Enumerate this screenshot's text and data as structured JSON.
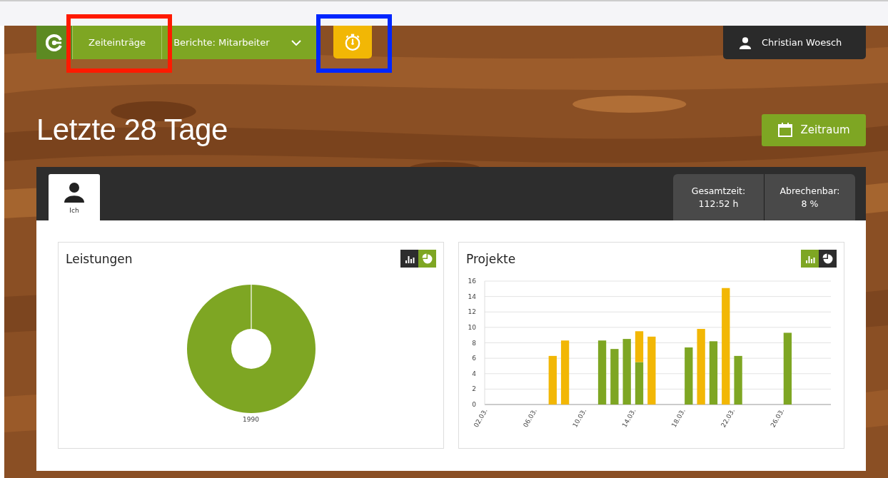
{
  "nav": {
    "items": [
      {
        "label": "Zeiteinträge",
        "selected": true
      },
      {
        "label": "Berichte: Mitarbeiter",
        "selected": false,
        "dropdown": true
      }
    ],
    "user": "Christian Woesch"
  },
  "annotations": [
    {
      "color": "#ff1a00"
    },
    {
      "color": "#0026ff"
    }
  ],
  "page_title": "Letzte 28 Tage",
  "date_button": "Zeitraum",
  "tabs": [
    {
      "label": "Ich",
      "selected": true
    }
  ],
  "stats": [
    {
      "label": "Gesamtzeit:",
      "value": "112:52 h"
    },
    {
      "label": "Abrechenbar:",
      "value": "8 %"
    }
  ],
  "cards": [
    {
      "title": "Leistungen",
      "views": [
        {
          "kind": "bar",
          "selected": false
        },
        {
          "kind": "pie",
          "selected": true
        }
      ],
      "donut": {
        "kind": "donut",
        "slice_label": "1990"
      }
    },
    {
      "title": "Projekte",
      "views": [
        {
          "kind": "bar",
          "selected": true
        },
        {
          "kind": "pie",
          "selected": false
        }
      ],
      "chart_data": {
        "type": "bar",
        "stacked": true,
        "grid": true,
        "categories": [
          "02.03.",
          null,
          null,
          null,
          "06.03.",
          null,
          null,
          null,
          "10.03.",
          null,
          null,
          null,
          "14.03.",
          null,
          null,
          null,
          "18.03.",
          null,
          null,
          null,
          "22.03.",
          null,
          null,
          null,
          "26.03.",
          null,
          null,
          null
        ],
        "ylim": [
          0,
          16
        ],
        "yticks": [
          0,
          2,
          4,
          6,
          8,
          10,
          12,
          14,
          16
        ],
        "series": [
          {
            "color": "#7ea623",
            "values": [
              0,
              0,
              0,
              0,
              0,
              0,
              0,
              0,
              0,
              8.3,
              7.2,
              8.5,
              5.5,
              0,
              0,
              0,
              7.4,
              0,
              8.2,
              0,
              6.3,
              0,
              0,
              0,
              9.3,
              0,
              0,
              0
            ]
          },
          {
            "color": "#f2b705",
            "values": [
              0,
              0,
              0,
              0,
              0,
              6.3,
              8.3,
              0,
              0,
              0,
              0,
              0,
              4.0,
              8.8,
              0,
              0,
              0,
              9.8,
              0,
              15.1,
              0,
              0,
              0,
              0,
              0,
              0,
              0,
              0
            ]
          }
        ]
      }
    }
  ]
}
